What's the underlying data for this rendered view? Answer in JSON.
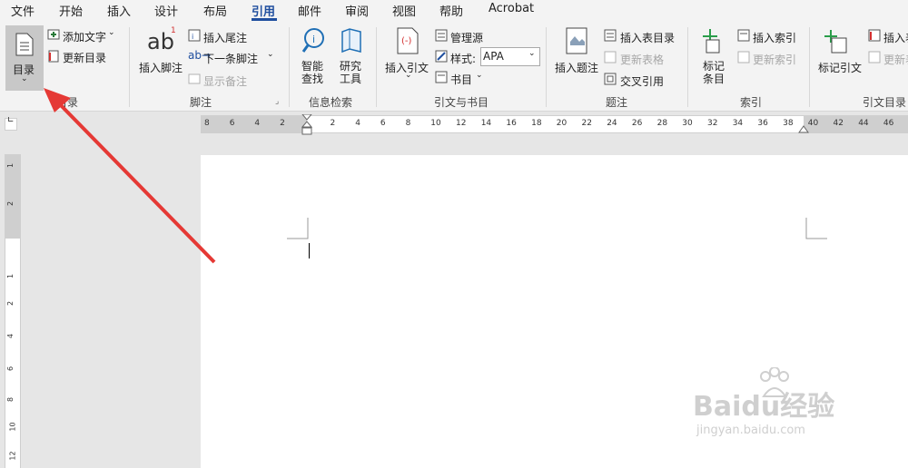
{
  "tabs": [
    "文件",
    "开始",
    "插入",
    "设计",
    "布局",
    "引用",
    "邮件",
    "审阅",
    "视图",
    "帮助",
    "Acrobat"
  ],
  "active_tab": "引用",
  "ribbon": {
    "toc": {
      "label": "目录",
      "add_text": "添加文字",
      "update": "更新目录",
      "group": "目录"
    },
    "footnotes": {
      "insert_footnote": "插入脚注",
      "insert_endnote": "插入尾注",
      "next_footnote": "下一条脚注",
      "show_notes": "显示备注",
      "group": "脚注"
    },
    "research": {
      "smart_lookup": "智能\n查找",
      "researcher": "研究\n工具",
      "group": "信息检索"
    },
    "citations": {
      "insert_citation": "插入引文",
      "manage_sources": "管理源",
      "style_label": "样式:",
      "style_value": "APA",
      "bibliography": "书目",
      "group": "引文与书目"
    },
    "captions": {
      "insert_caption": "插入题注",
      "insert_table_of_figures": "插入表目录",
      "update_table": "更新表格",
      "cross_reference": "交叉引用",
      "group": "题注"
    },
    "index": {
      "mark_entry": "标记\n条目",
      "insert_index": "插入索引",
      "update_index": "更新索引",
      "group": "索引"
    },
    "authorities": {
      "mark_citation": "标记引文",
      "insert_toa": "插入表",
      "update_toa": "更新表",
      "group": "引文目录"
    }
  },
  "ruler_h": [
    "8",
    "6",
    "4",
    "2",
    "",
    "2",
    "4",
    "6",
    "8",
    "10",
    "12",
    "14",
    "16",
    "18",
    "20",
    "22",
    "24",
    "26",
    "28",
    "30",
    "32",
    "34",
    "36",
    "38",
    "40",
    "42",
    "44",
    "46"
  ],
  "ruler_v": [
    "1",
    "2",
    "",
    "1",
    "2",
    "4",
    "6",
    "8",
    "10",
    "12"
  ],
  "watermark": {
    "brand": "Baidu经验",
    "url": "jingyan.baidu.com"
  },
  "colors": {
    "accent": "#1f4e9e",
    "arrow": "#e53935"
  }
}
